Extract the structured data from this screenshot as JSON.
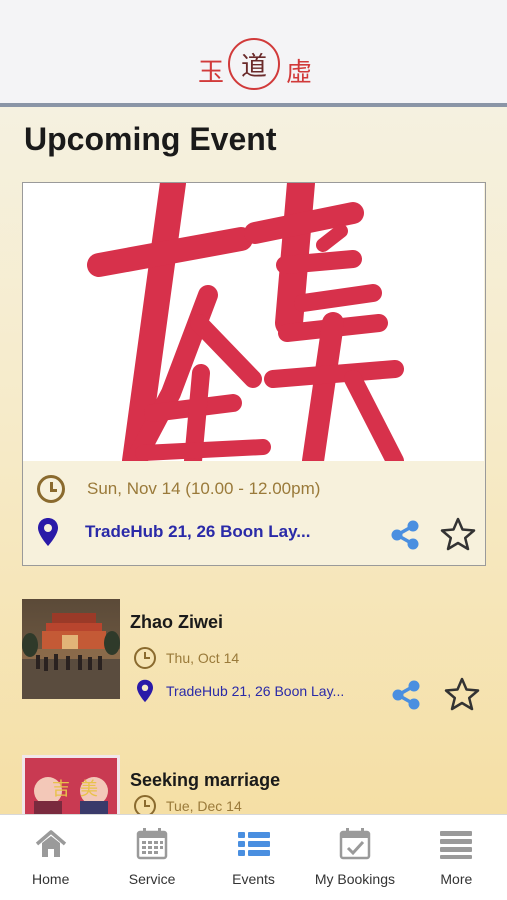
{
  "header": {
    "logo_left": "玉",
    "logo_center": "道",
    "logo_right": "虛"
  },
  "main": {
    "section_title": "Upcoming Event",
    "featured": {
      "date": "Sun, Nov 14 (10.00 - 12.00pm)",
      "location": "TradeHub 21, 26 Boon Lay..."
    },
    "items": [
      {
        "title": "Zhao Ziwei",
        "date": "Thu, Oct 14",
        "location": "TradeHub 21, 26 Boon Lay..."
      },
      {
        "title": "Seeking marriage",
        "date": "Tue, Dec 14"
      }
    ]
  },
  "nav": {
    "items": [
      {
        "label": "Home",
        "icon": "home-icon"
      },
      {
        "label": "Service",
        "icon": "calendar-icon"
      },
      {
        "label": "Events",
        "icon": "list-icon"
      },
      {
        "label": "My Bookings",
        "icon": "calendar-check-icon"
      },
      {
        "label": "More",
        "icon": "menu-icon"
      }
    ],
    "active": "Events"
  },
  "colors": {
    "accent": "#4a8fe0",
    "date_text": "#9a7a3a",
    "location_text": "#2a2aa8",
    "logo_red": "#d13a3a"
  }
}
